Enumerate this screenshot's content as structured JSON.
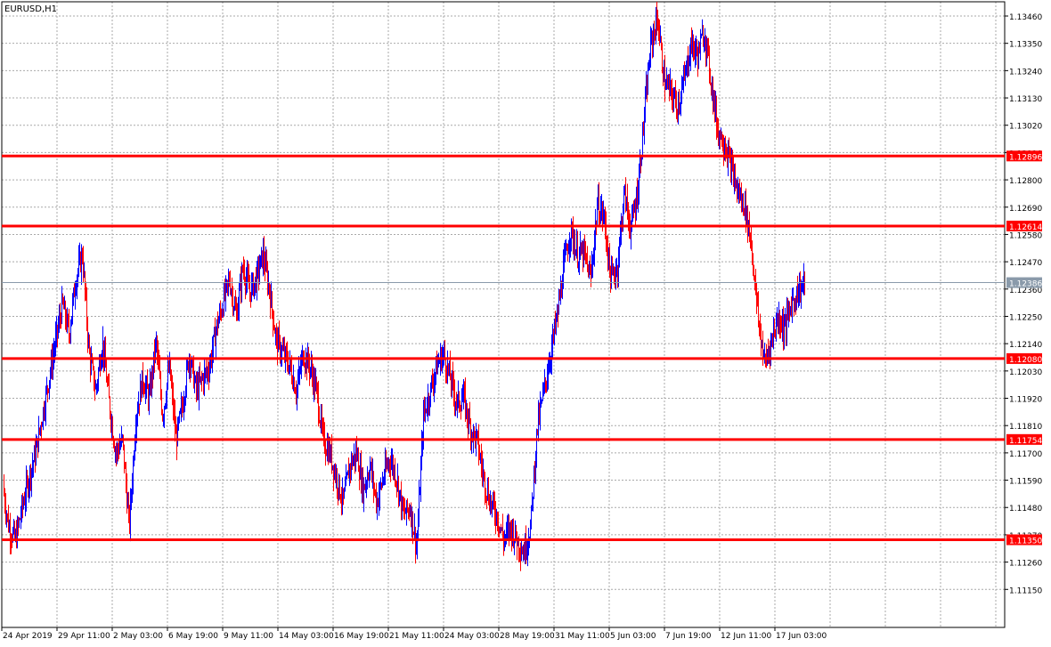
{
  "symbol_label": "EURUSD,H1",
  "colors": {
    "background": "#ffffff",
    "grid": "#a9a9a9",
    "frame": "#000000",
    "up_candle": "#0000ff",
    "down_candle": "#ff0000",
    "level_line": "#ff0000",
    "level_tag_text": "#ffffff",
    "current_price": "#8a9aaa"
  },
  "chart_data": {
    "type": "line",
    "title": "EURUSD,H1",
    "xlabel": "",
    "ylabel": "",
    "ylim": [
      1.1108,
      1.1348
    ],
    "grid": true,
    "y_ticks": [
      1.1346,
      1.1335,
      1.1324,
      1.1313,
      1.1302,
      1.1291,
      1.128,
      1.1269,
      1.1258,
      1.1247,
      1.1236,
      1.1225,
      1.1214,
      1.1203,
      1.1192,
      1.1181,
      1.117,
      1.1159,
      1.1148,
      1.1137,
      1.1126,
      1.1115
    ],
    "y_tick_labels": [
      "1.13460",
      "1.13350",
      "1.13240",
      "1.13130",
      "1.13020",
      "1.12910",
      "1.12800",
      "1.12690",
      "1.12580",
      "1.12470",
      "1.12360",
      "1.12250",
      "1.12140",
      "1.12030",
      "1.11920",
      "1.11810",
      "1.11700",
      "1.11590",
      "1.11480",
      "1.11370",
      "1.11260",
      "1.11150"
    ],
    "x_labels": [
      "24 Apr 2019",
      "29 Apr 11:00",
      "2 May 03:00",
      "6 May 19:00",
      "9 May 11:00",
      "14 May 03:00",
      "16 May 19:00",
      "21 May 11:00",
      "24 May 03:00",
      "28 May 19:00",
      "31 May 11:00",
      "5 Jun 03:00",
      "7 Jun 19:00",
      "12 Jun 11:00",
      "17 Jun 03:00"
    ],
    "x_label_fractions": [
      0.0,
      0.0714,
      0.1429,
      0.2143,
      0.2857,
      0.3571,
      0.4286,
      0.5,
      0.5714,
      0.6429,
      0.7143,
      0.7857,
      0.8571,
      0.9286,
      1.0
    ],
    "levels": [
      {
        "value": 1.12896,
        "label": "1.12896"
      },
      {
        "value": 1.12614,
        "label": "1.12614"
      },
      {
        "value": 1.1208,
        "label": "1.12080"
      },
      {
        "value": 1.11754,
        "label": "1.11754"
      },
      {
        "value": 1.1135,
        "label": "1.11350"
      }
    ],
    "current_price": {
      "value": 1.12386,
      "label": "1.12386"
    },
    "price_path": {
      "x_end_fraction": 1.0,
      "values": [
        1.1158,
        1.114,
        1.1135,
        1.1148,
        1.116,
        1.117,
        1.1185,
        1.12,
        1.1215,
        1.123,
        1.1218,
        1.124,
        1.125,
        1.121,
        1.1195,
        1.1215,
        1.119,
        1.117,
        1.1175,
        1.114,
        1.1185,
        1.12,
        1.1192,
        1.1215,
        1.1185,
        1.1205,
        1.1175,
        1.119,
        1.121,
        1.1195,
        1.12,
        1.1205,
        1.122,
        1.123,
        1.124,
        1.1225,
        1.1245,
        1.1235,
        1.124,
        1.125,
        1.1235,
        1.1215,
        1.121,
        1.1205,
        1.1195,
        1.121,
        1.1205,
        1.1195,
        1.1175,
        1.117,
        1.116,
        1.115,
        1.1165,
        1.117,
        1.1155,
        1.1165,
        1.115,
        1.116,
        1.1168,
        1.116,
        1.1145,
        1.1148,
        1.1132,
        1.1185,
        1.1195,
        1.1205,
        1.121,
        1.12,
        1.119,
        1.1192,
        1.118,
        1.1175,
        1.116,
        1.115,
        1.1145,
        1.1135,
        1.114,
        1.1135,
        1.113,
        1.114,
        1.118,
        1.1195,
        1.121,
        1.1225,
        1.1245,
        1.126,
        1.125,
        1.125,
        1.124,
        1.127,
        1.1265,
        1.124,
        1.1245,
        1.1275,
        1.126,
        1.1275,
        1.1305,
        1.1335,
        1.1345,
        1.132,
        1.1315,
        1.131,
        1.132,
        1.1335,
        1.133,
        1.134,
        1.132,
        1.13,
        1.1295,
        1.1285,
        1.1275,
        1.127,
        1.1255,
        1.1225,
        1.1206,
        1.1215,
        1.1225,
        1.122,
        1.123,
        1.1235,
        1.12386
      ]
    }
  }
}
